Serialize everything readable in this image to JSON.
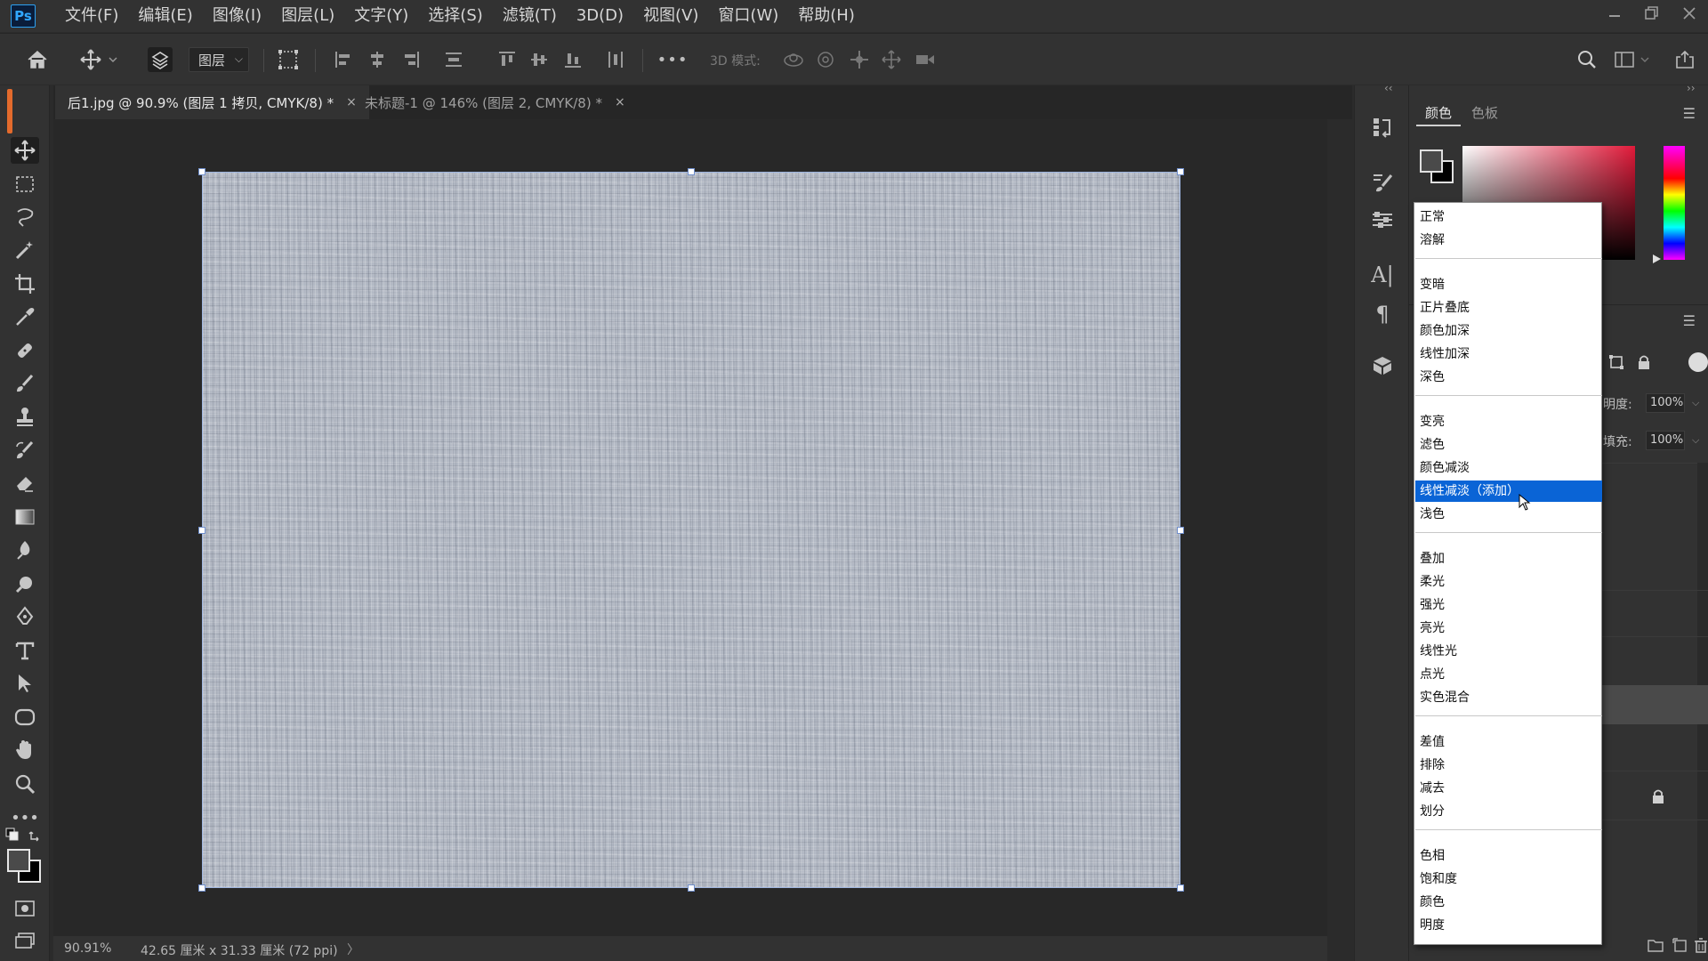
{
  "app": {
    "logo": "Ps"
  },
  "menu": [
    {
      "label": "文件(F)"
    },
    {
      "label": "编辑(E)"
    },
    {
      "label": "图像(I)"
    },
    {
      "label": "图层(L)"
    },
    {
      "label": "文字(Y)"
    },
    {
      "label": "选择(S)"
    },
    {
      "label": "滤镜(T)"
    },
    {
      "label": "3D(D)"
    },
    {
      "label": "视图(V)"
    },
    {
      "label": "窗口(W)"
    },
    {
      "label": "帮助(H)"
    }
  ],
  "window_controls": {
    "minimize_icon": "minimize-icon",
    "restore_icon": "restore-icon",
    "close_icon": "close-icon"
  },
  "options_bar": {
    "auto_select_target": "图层",
    "mode_3d_label": "3D 模式:",
    "more_label": "•••"
  },
  "tabs": [
    {
      "label": "后1.jpg @ 90.9% (图层 1 拷贝, CMYK/8) *",
      "active": true,
      "close": "×"
    },
    {
      "label": "未标题-1 @ 146% (图层 2, CMYK/8) *",
      "active": false,
      "close": "×"
    }
  ],
  "status": {
    "zoom": "90.91%",
    "doc_size": "42.65 厘米 x 31.33 厘米 (72 ppi)",
    "arrow": "〉"
  },
  "color_panel": {
    "tab_color": "颜色",
    "tab_swatches": "色板",
    "foreground": "#4a4a4a",
    "background": "#000000"
  },
  "layers_panel": {
    "opacity_label": "明度:",
    "opacity_value": "100%",
    "fill_label": "填充:",
    "fill_value": "100%"
  },
  "blend_modes": {
    "selected": "线性减淡（添加）",
    "groups": [
      [
        "正常",
        "溶解"
      ],
      [
        "变暗",
        "正片叠底",
        "颜色加深",
        "线性加深",
        "深色"
      ],
      [
        "变亮",
        "滤色",
        "颜色减淡",
        "线性减淡（添加）",
        "浅色"
      ],
      [
        "叠加",
        "柔光",
        "强光",
        "亮光",
        "线性光",
        "点光",
        "实色混合"
      ],
      [
        "差值",
        "排除",
        "减去",
        "划分"
      ],
      [
        "色相",
        "饱和度",
        "颜色",
        "明度"
      ]
    ]
  },
  "colors": {
    "selection_blue": "#0a64d6",
    "accent_logo": "#31a8ff"
  }
}
